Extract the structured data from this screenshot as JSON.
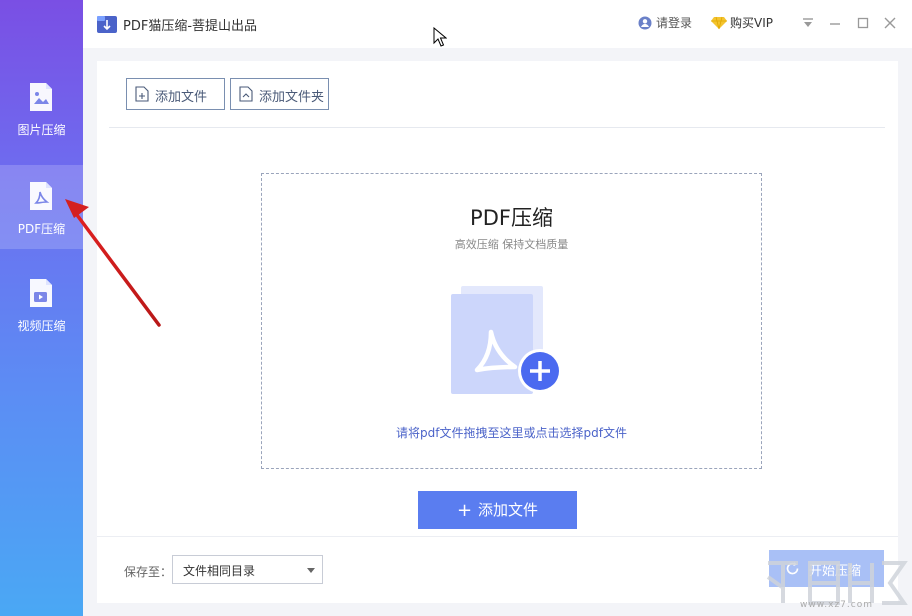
{
  "window": {
    "title": "PDF猫压缩-菩提山出品",
    "login_label": "请登录",
    "vip_label": "购买VIP"
  },
  "sidebar": {
    "items": [
      {
        "label": "图片压缩",
        "icon": "image-file-icon",
        "active": false
      },
      {
        "label": "PDF压缩",
        "icon": "pdf-file-icon",
        "active": true
      },
      {
        "label": "视频压缩",
        "icon": "video-file-icon",
        "active": false
      }
    ]
  },
  "toolbar": {
    "add_file_label": "添加文件",
    "add_folder_label": "添加文件夹"
  },
  "dropzone": {
    "title": "PDF压缩",
    "subtitle": "高效压缩 保持文档质量",
    "hint": "请将pdf文件拖拽至这里或点击选择pdf文件"
  },
  "add_file_button_label": "添加文件",
  "save": {
    "label": "保存至：",
    "selected_value": "文件相同目录"
  },
  "start_button_label": "开始压缩",
  "watermark": {
    "caption": "www.xz7.com"
  },
  "colors": {
    "accent": "#5a7df0",
    "sidebar_top": "#7a4fe4",
    "sidebar_bottom": "#4aa8f4",
    "annotation_arrow": "#d42020"
  }
}
